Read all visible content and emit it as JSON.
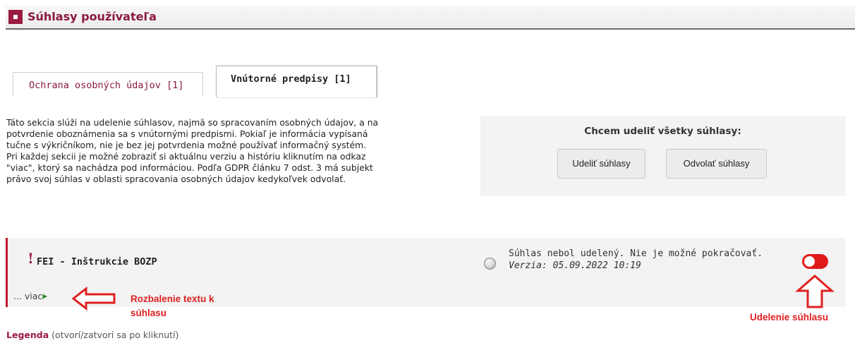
{
  "header": {
    "title": "Súhlasy používateľa",
    "icon": "square-marker-icon",
    "accent": "#9b1b3f"
  },
  "tabs": [
    {
      "label": "Ochrana osobných údajov [1]",
      "active": false
    },
    {
      "label": "Vnútorné predpisy [1]",
      "active": true
    }
  ],
  "description": [
    "Táto sekcia slúži na udelenie súhlasov, najmä so spracovaním osobných údajov, a na",
    "potvrdenie oboznámenia sa s vnútornými predpismi. Pokiaľ je informácia vypísaná",
    "tučne s výkričníkom, nie je bez jej potvrdenia možné používať informačný systém.",
    "Pri každej sekcii je možné zobraziť si aktuálnu verziu a históriu kliknutím na odkaz",
    "\"viac\", ktorý sa nachádza pod informáciou. Podľa GDPR článku 7 odst. 3 má subjekt",
    "právo svoj súhlas v oblasti spracovania osobných údajov kedykoľvek odvolať."
  ],
  "consent_all": {
    "heading": "Chcem udeliť všetky súhlasy:",
    "grant_label": "Udeliť súhlasy",
    "revoke_label": "Odvolať súhlasy"
  },
  "consent_item": {
    "mark": "!",
    "name": "FEI - Inštrukcie BOZP",
    "more_label": "... viac",
    "status": "Súhlas nebol udelený. Nie je možné pokračovať.",
    "version": "Verzia: 05.09.2022 10:19",
    "toggle_on": false,
    "toggle_color": "#e01a1a"
  },
  "annotations": {
    "expand_text": "Rozbalenie textu k súhlasu",
    "grant_consent": "Udelenie súhlasu",
    "color": "#e02020"
  },
  "legend": {
    "label": "Legenda",
    "hint": "(otvorí/zatvorí sa po kliknutí)"
  }
}
